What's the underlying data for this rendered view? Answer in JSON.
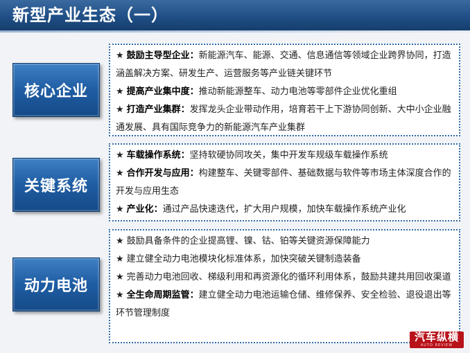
{
  "header": {
    "title": "新型产业生态（一）"
  },
  "sections": [
    {
      "label": "核心企业",
      "items": [
        {
          "kw": "鼓励主导型企业：",
          "text": "新能源汽车、能源、交通、信息通信等领域企业跨界协同，打造涵盖解决方案、研发生产、运营服务等产业链关键环节"
        },
        {
          "kw": "提高产业集中度：",
          "text": "推动新能源整车、动力电池等零部件企业优化重组"
        },
        {
          "kw": "打造产业集群：",
          "text": "发挥龙头企业带动作用，培育若干上下游协同创新、大中小企业融通发展、具有国际竞争力的新能源汽车产业集群"
        }
      ]
    },
    {
      "label": "关键系统",
      "items": [
        {
          "kw": "车载操作系统：",
          "text": "坚持软硬协同攻关，集中开发车规级车载操作系统"
        },
        {
          "kw": "合作开发与应用：",
          "text": "构建整车、关键零部件、基础数据与软件等市场主体深度合作的开发与应用生态"
        },
        {
          "kw": "产业化：",
          "text": "通过产品快速迭代，扩大用户规模，加快车载操作系统产业化"
        }
      ]
    },
    {
      "label": "动力电池",
      "items": [
        {
          "kw": "",
          "text": "鼓励具备条件的企业提高锂、镍、钴、铂等关键资源保障能力"
        },
        {
          "kw": "",
          "text": "建立健全动力电池模块化标准体系，加快突破关键制造装备"
        },
        {
          "kw": "",
          "text": "完善动力电池回收、梯级利用和再资源化的循环利用体系，鼓励共建共用回收渠道"
        },
        {
          "kw": "全生命周期监管：",
          "text": "建立健全动力电池运输仓储、维修保养、安全检验、退役退出等环节管理制度"
        }
      ]
    }
  ],
  "star": "★",
  "logo": {
    "text": "汽车纵横",
    "subtitle": "AUTO REVIEW"
  }
}
